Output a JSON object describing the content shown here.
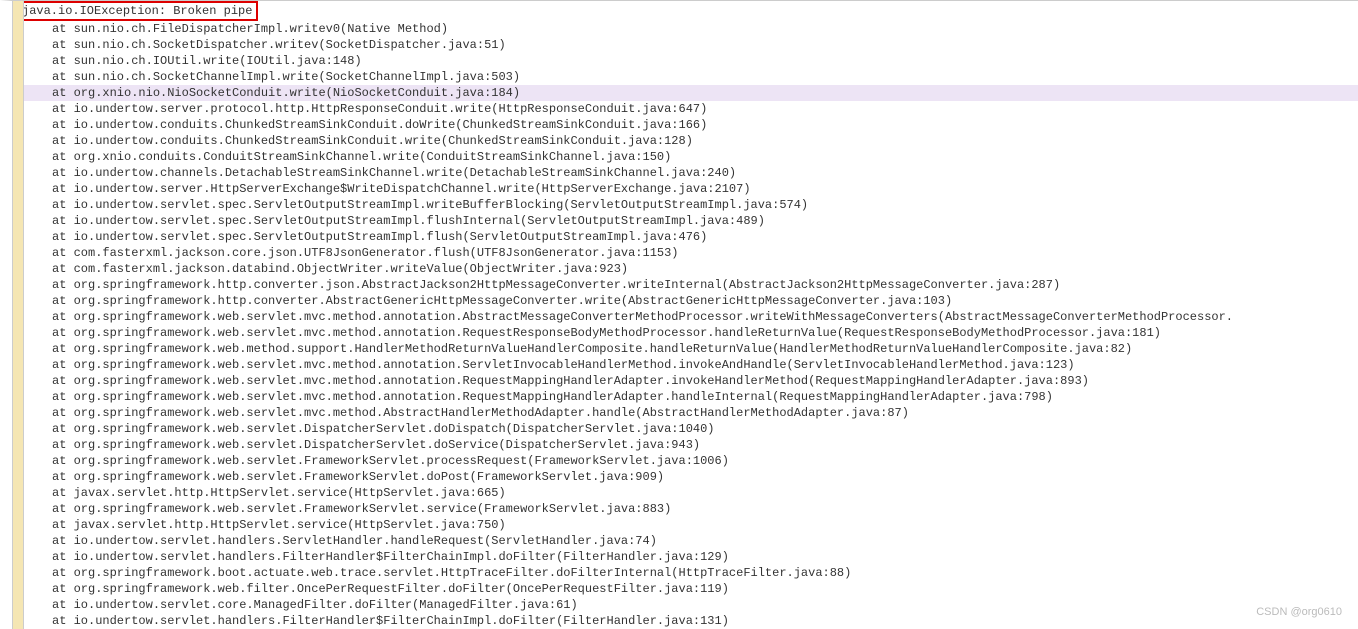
{
  "exception": "java.io.IOException: Broken pipe",
  "watermark": "CSDN @org0610",
  "stack": [
    "at sun.nio.ch.FileDispatcherImpl.writev0(Native Method)",
    "at sun.nio.ch.SocketDispatcher.writev(SocketDispatcher.java:51)",
    "at sun.nio.ch.IOUtil.write(IOUtil.java:148)",
    "at sun.nio.ch.SocketChannelImpl.write(SocketChannelImpl.java:503)",
    "at org.xnio.nio.NioSocketConduit.write(NioSocketConduit.java:184)",
    "at io.undertow.server.protocol.http.HttpResponseConduit.write(HttpResponseConduit.java:647)",
    "at io.undertow.conduits.ChunkedStreamSinkConduit.doWrite(ChunkedStreamSinkConduit.java:166)",
    "at io.undertow.conduits.ChunkedStreamSinkConduit.write(ChunkedStreamSinkConduit.java:128)",
    "at org.xnio.conduits.ConduitStreamSinkChannel.write(ConduitStreamSinkChannel.java:150)",
    "at io.undertow.channels.DetachableStreamSinkChannel.write(DetachableStreamSinkChannel.java:240)",
    "at io.undertow.server.HttpServerExchange$WriteDispatchChannel.write(HttpServerExchange.java:2107)",
    "at io.undertow.servlet.spec.ServletOutputStreamImpl.writeBufferBlocking(ServletOutputStreamImpl.java:574)",
    "at io.undertow.servlet.spec.ServletOutputStreamImpl.flushInternal(ServletOutputStreamImpl.java:489)",
    "at io.undertow.servlet.spec.ServletOutputStreamImpl.flush(ServletOutputStreamImpl.java:476)",
    "at com.fasterxml.jackson.core.json.UTF8JsonGenerator.flush(UTF8JsonGenerator.java:1153)",
    "at com.fasterxml.jackson.databind.ObjectWriter.writeValue(ObjectWriter.java:923)",
    "at org.springframework.http.converter.json.AbstractJackson2HttpMessageConverter.writeInternal(AbstractJackson2HttpMessageConverter.java:287)",
    "at org.springframework.http.converter.AbstractGenericHttpMessageConverter.write(AbstractGenericHttpMessageConverter.java:103)",
    "at org.springframework.web.servlet.mvc.method.annotation.AbstractMessageConverterMethodProcessor.writeWithMessageConverters(AbstractMessageConverterMethodProcessor.",
    "at org.springframework.web.servlet.mvc.method.annotation.RequestResponseBodyMethodProcessor.handleReturnValue(RequestResponseBodyMethodProcessor.java:181)",
    "at org.springframework.web.method.support.HandlerMethodReturnValueHandlerComposite.handleReturnValue(HandlerMethodReturnValueHandlerComposite.java:82)",
    "at org.springframework.web.servlet.mvc.method.annotation.ServletInvocableHandlerMethod.invokeAndHandle(ServletInvocableHandlerMethod.java:123)",
    "at org.springframework.web.servlet.mvc.method.annotation.RequestMappingHandlerAdapter.invokeHandlerMethod(RequestMappingHandlerAdapter.java:893)",
    "at org.springframework.web.servlet.mvc.method.annotation.RequestMappingHandlerAdapter.handleInternal(RequestMappingHandlerAdapter.java:798)",
    "at org.springframework.web.servlet.mvc.method.AbstractHandlerMethodAdapter.handle(AbstractHandlerMethodAdapter.java:87)",
    "at org.springframework.web.servlet.DispatcherServlet.doDispatch(DispatcherServlet.java:1040)",
    "at org.springframework.web.servlet.DispatcherServlet.doService(DispatcherServlet.java:943)",
    "at org.springframework.web.servlet.FrameworkServlet.processRequest(FrameworkServlet.java:1006)",
    "at org.springframework.web.servlet.FrameworkServlet.doPost(FrameworkServlet.java:909)",
    "at javax.servlet.http.HttpServlet.service(HttpServlet.java:665)",
    "at org.springframework.web.servlet.FrameworkServlet.service(FrameworkServlet.java:883)",
    "at javax.servlet.http.HttpServlet.service(HttpServlet.java:750)",
    "at io.undertow.servlet.handlers.ServletHandler.handleRequest(ServletHandler.java:74)",
    "at io.undertow.servlet.handlers.FilterHandler$FilterChainImpl.doFilter(FilterHandler.java:129)",
    "at org.springframework.boot.actuate.web.trace.servlet.HttpTraceFilter.doFilterInternal(HttpTraceFilter.java:88)",
    "at org.springframework.web.filter.OncePerRequestFilter.doFilter(OncePerRequestFilter.java:119)",
    "at io.undertow.servlet.core.ManagedFilter.doFilter(ManagedFilter.java:61)",
    "at io.undertow.servlet.handlers.FilterHandler$FilterChainImpl.doFilter(FilterHandler.java:131)"
  ],
  "highlighted_index": 4
}
